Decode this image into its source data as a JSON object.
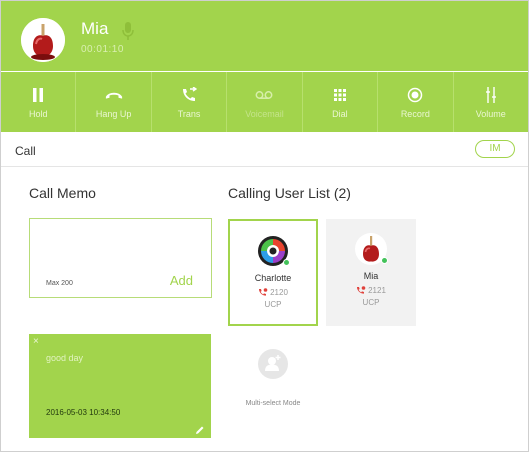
{
  "header": {
    "caller_name": "Mia",
    "call_timer": "00:01:10",
    "mic_icon": "microphone-icon",
    "avatar_icon": "candy-apple-avatar"
  },
  "toolbar": {
    "buttons": [
      {
        "label": "Hold",
        "icon": "pause-icon",
        "enabled": true
      },
      {
        "label": "Hang Up",
        "icon": "hang-up-icon",
        "enabled": true
      },
      {
        "label": "Trans",
        "icon": "transfer-icon",
        "enabled": true
      },
      {
        "label": "Voicemail",
        "icon": "voicemail-icon",
        "enabled": false
      },
      {
        "label": "Dial",
        "icon": "dialpad-icon",
        "enabled": true
      },
      {
        "label": "Record",
        "icon": "record-icon",
        "enabled": true
      },
      {
        "label": "Volume",
        "icon": "volume-sliders-icon",
        "enabled": true
      }
    ]
  },
  "callbar": {
    "label": "Call",
    "im_label": "IM"
  },
  "memo": {
    "title": "Call Memo",
    "max_label": "Max 200",
    "add_label": "Add",
    "note": {
      "close": "×",
      "text": "good day",
      "timestamp": "2016-05-03 10:34:50"
    }
  },
  "users": {
    "title": "Calling User List (2)",
    "list": [
      {
        "name": "Charlotte",
        "ext": "2120",
        "type": "UCP",
        "status": "online"
      },
      {
        "name": "Mia",
        "ext": "2121",
        "type": "UCP",
        "status": "online"
      }
    ],
    "multiselect_label": "Multi-select Mode"
  },
  "colors": {
    "accent": "#a2d44c",
    "online": "#43c25a",
    "missed_call": "#e0413b"
  }
}
